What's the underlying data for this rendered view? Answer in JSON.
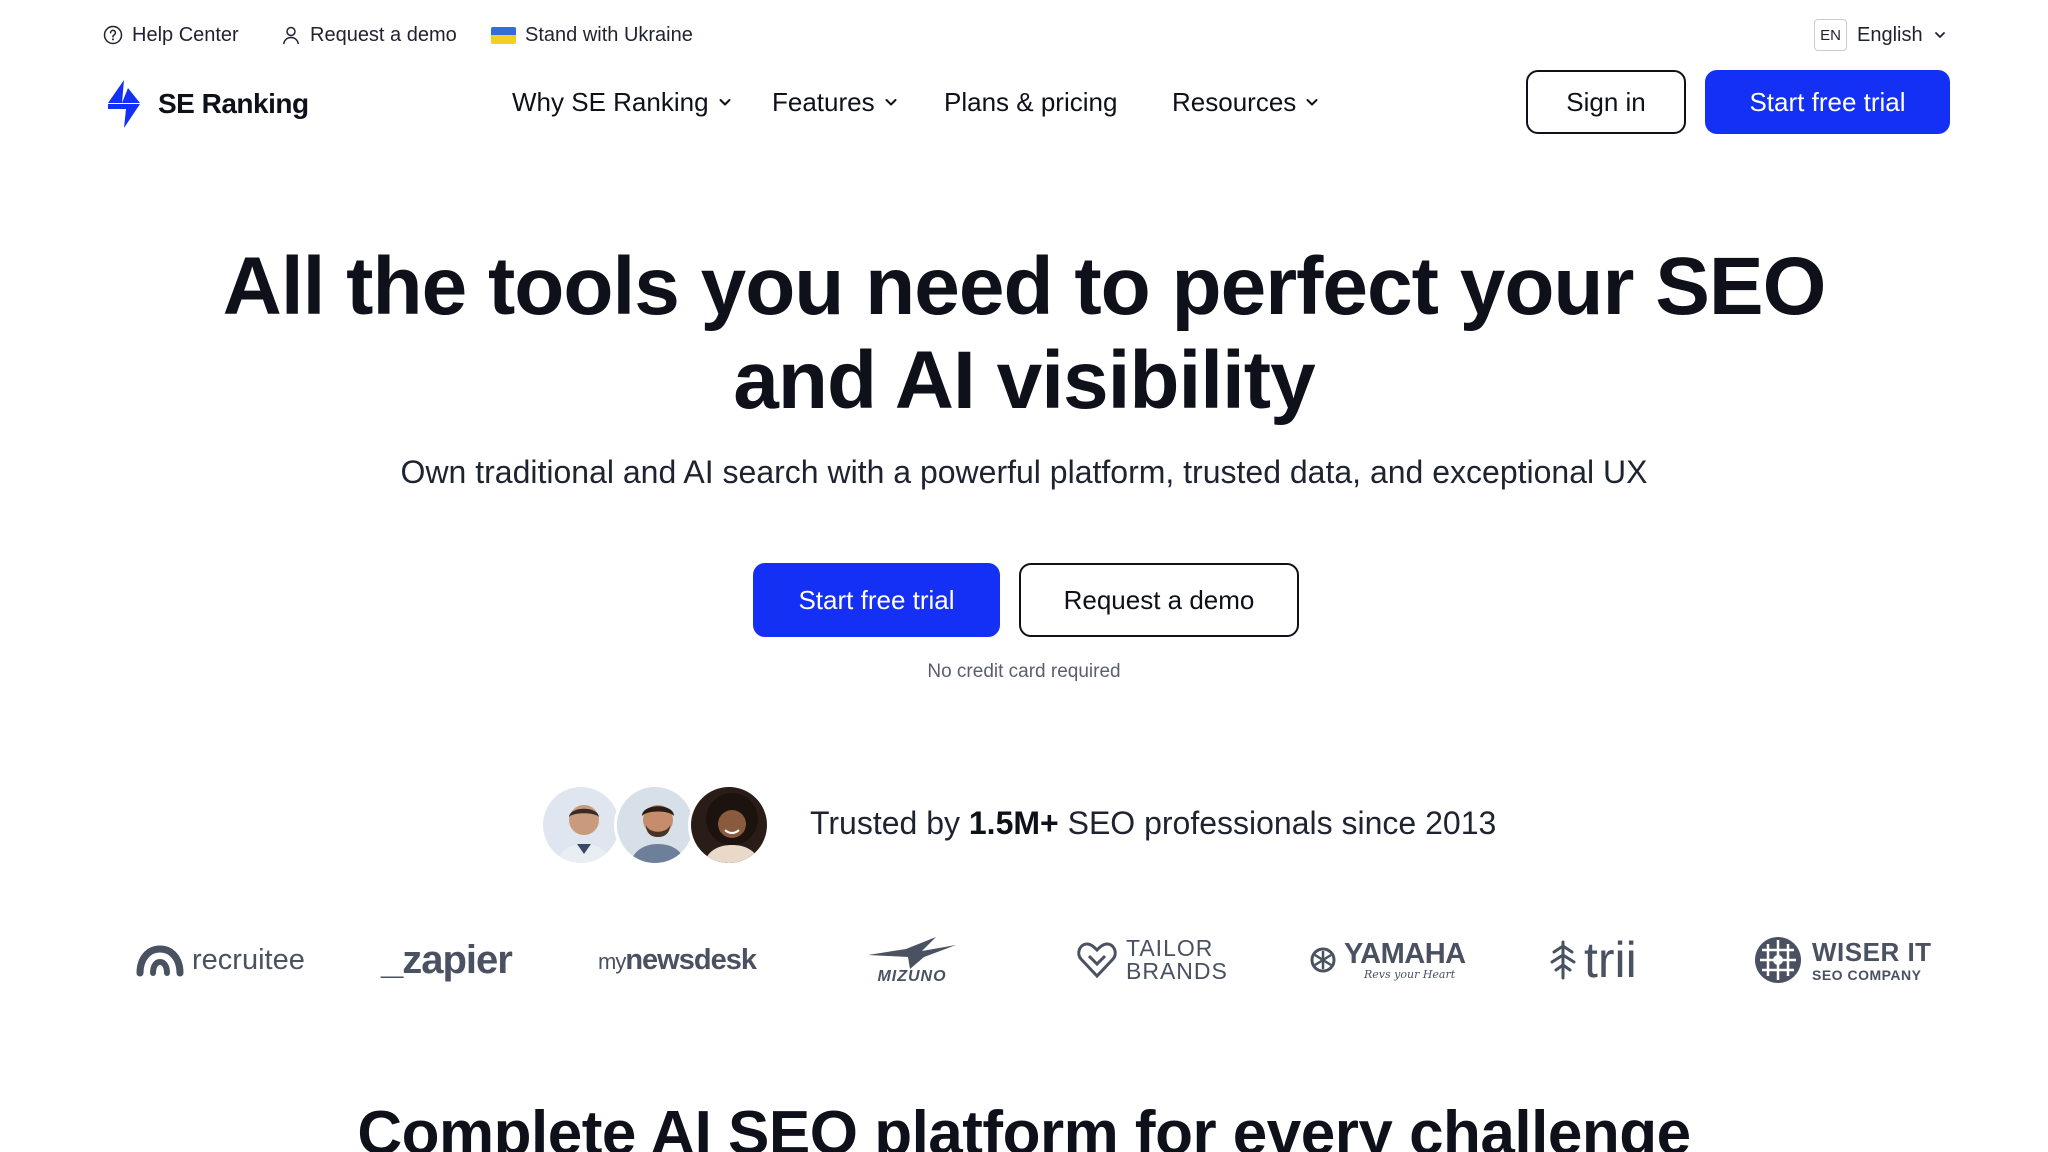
{
  "utility": {
    "help_center": "Help Center",
    "request_demo": "Request a demo",
    "ukraine": "Stand with Ukraine",
    "lang_code": "EN",
    "lang_label": "English"
  },
  "brand": {
    "name": "SE Ranking",
    "accent": "#1530F5"
  },
  "nav": {
    "items": [
      {
        "label": "Why SE Ranking"
      },
      {
        "label": "Features"
      },
      {
        "label": "Plans & pricing"
      },
      {
        "label": "Resources"
      }
    ],
    "sign_in": "Sign in",
    "start_trial": "Start free trial"
  },
  "hero": {
    "title_line1": "All the tools you need to perfect your SEO",
    "title_line2": "and AI visibility",
    "subtitle": "Own traditional and AI search with a powerful platform, trusted data, and exceptional UX",
    "cta_primary": "Start free trial",
    "cta_secondary": "Request a demo",
    "note": "No credit card required"
  },
  "trust": {
    "prefix": "Trusted by ",
    "highlight": "1.5M+",
    "suffix": " SEO professionals since 2013"
  },
  "logos": {
    "recruitee": "recruitee",
    "zapier": "_zapier",
    "newsdesk_prefix": "my",
    "newsdesk": "newsdesk",
    "mizuno": "MIZUNO",
    "tailor_line1": "TAILOR",
    "tailor_line2": "BRANDS",
    "yamaha": "YAMAHA",
    "yamaha_tag": "Revs your Heart",
    "trii": "trii",
    "wiser_line1": "WISER IT",
    "wiser_line2": "SEO COMPANY"
  },
  "section": {
    "title": "Complete AI SEO platform for every challenge"
  }
}
